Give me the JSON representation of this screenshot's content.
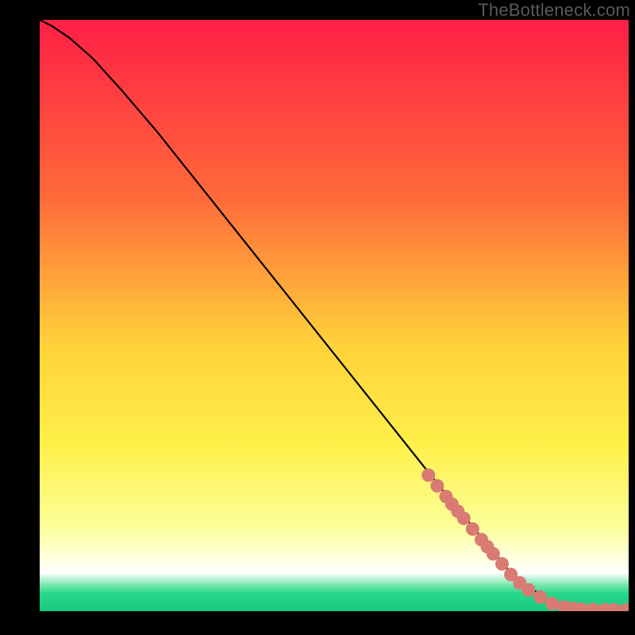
{
  "watermark": "TheBottleneck.com",
  "chart_data": {
    "type": "line",
    "title": "",
    "xlabel": "",
    "ylabel": "",
    "xlim": [
      0,
      100
    ],
    "ylim": [
      0,
      100
    ],
    "grid": false,
    "legend": false,
    "background_gradient": {
      "stops": [
        {
          "offset": 0.0,
          "color": "#ff1f46"
        },
        {
          "offset": 0.3,
          "color": "#ff6a3a"
        },
        {
          "offset": 0.55,
          "color": "#ffd23a"
        },
        {
          "offset": 0.72,
          "color": "#fff04a"
        },
        {
          "offset": 0.86,
          "color": "#fcff9a"
        },
        {
          "offset": 0.935,
          "color": "#ffffff"
        },
        {
          "offset": 0.955,
          "color": "#7de8b0"
        },
        {
          "offset": 0.97,
          "color": "#27d88c"
        },
        {
          "offset": 1.0,
          "color": "#17c97e"
        }
      ]
    },
    "series": [
      {
        "name": "curve",
        "type": "line",
        "x": [
          0,
          2,
          5,
          9,
          14,
          20,
          30,
          40,
          50,
          60,
          70,
          80,
          87,
          90,
          93,
          96,
          100
        ],
        "y": [
          100,
          99,
          97,
          93.5,
          88,
          81,
          68.5,
          56,
          43.5,
          31,
          18.5,
          6.5,
          1.2,
          0.6,
          0.35,
          0.25,
          0.2
        ]
      },
      {
        "name": "markers",
        "type": "scatter",
        "marker_color": "#d97b73",
        "x": [
          66,
          67.5,
          69,
          70,
          71,
          72,
          73.5,
          75,
          76,
          77,
          78.5,
          80,
          81.5,
          83,
          85,
          87,
          89,
          90.5,
          92,
          94,
          96,
          97.5,
          99.5
        ],
        "y": [
          23.0,
          21.2,
          19.4,
          18.1,
          16.9,
          15.7,
          13.9,
          12.1,
          10.9,
          9.7,
          8.0,
          6.2,
          4.8,
          3.6,
          2.4,
          1.3,
          0.7,
          0.5,
          0.35,
          0.3,
          0.25,
          0.23,
          0.2
        ]
      }
    ]
  }
}
